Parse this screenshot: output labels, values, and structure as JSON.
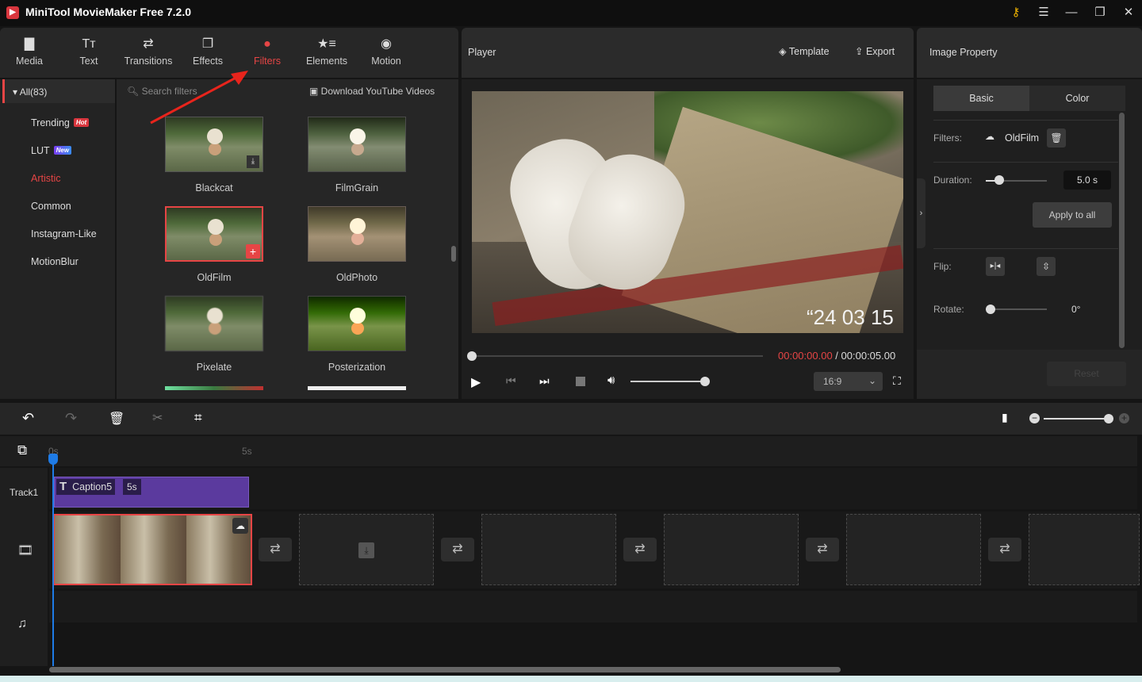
{
  "app": {
    "title": "MiniTool MovieMaker Free 7.2.0",
    "logo": "movie-maker-logo"
  },
  "window_controls": [
    "key-icon",
    "menu-icon",
    "minimize-icon",
    "maximize-icon",
    "close-icon"
  ],
  "tabs": [
    {
      "label": "Media",
      "icon": "folder-icon"
    },
    {
      "label": "Text",
      "icon": "text-icon"
    },
    {
      "label": "Transitions",
      "icon": "transitions-icon"
    },
    {
      "label": "Effects",
      "icon": "effects-icon"
    },
    {
      "label": "Filters",
      "icon": "filters-icon",
      "active": true
    },
    {
      "label": "Elements",
      "icon": "elements-icon"
    },
    {
      "label": "Motion",
      "icon": "motion-icon"
    }
  ],
  "categories": {
    "all": "All(83)",
    "items": [
      {
        "label": "Trending",
        "badge": "Hot",
        "badge_color": "#d9363e"
      },
      {
        "label": "LUT",
        "badge": "New",
        "badge_color": "#6a4cf0"
      },
      {
        "label": "Artistic",
        "active": true
      },
      {
        "label": "Common"
      },
      {
        "label": "Instagram-Like"
      },
      {
        "label": "MotionBlur"
      }
    ]
  },
  "search": {
    "placeholder": "Search filters"
  },
  "download_link": "Download YouTube Videos",
  "filters": [
    {
      "name": "Blackcat",
      "state": "download"
    },
    {
      "name": "FilmGrain"
    },
    {
      "name": "OldFilm",
      "state": "selected"
    },
    {
      "name": "OldPhoto"
    },
    {
      "name": "Pixelate"
    },
    {
      "name": "Posterization"
    }
  ],
  "player": {
    "title": "Player",
    "template": "Template",
    "export": "Export",
    "overlay_text": "“24 03 15",
    "current_time": "00:00:00.00",
    "separator": " / ",
    "total_time": "00:00:05.00",
    "aspect": "16:9",
    "progress": 0,
    "volume": 1.0
  },
  "property": {
    "title": "Image Property",
    "tab_basic": "Basic",
    "tab_color": "Color",
    "filters_label": "Filters:",
    "filter_value": "OldFilm",
    "duration_label": "Duration:",
    "duration_value": "5.0 s",
    "apply_all": "Apply to all",
    "flip_label": "Flip:",
    "rotate_label": "Rotate:",
    "rotate_value": "0°",
    "reset": "Reset"
  },
  "timeline": {
    "ruler": [
      "0s",
      "5s"
    ],
    "track1": "Track1",
    "caption": {
      "label": "Caption5",
      "duration": "5s"
    }
  },
  "colors": {
    "accent": "#e64545",
    "caption": "#5b3a9e",
    "playhead": "#1e7be6"
  }
}
